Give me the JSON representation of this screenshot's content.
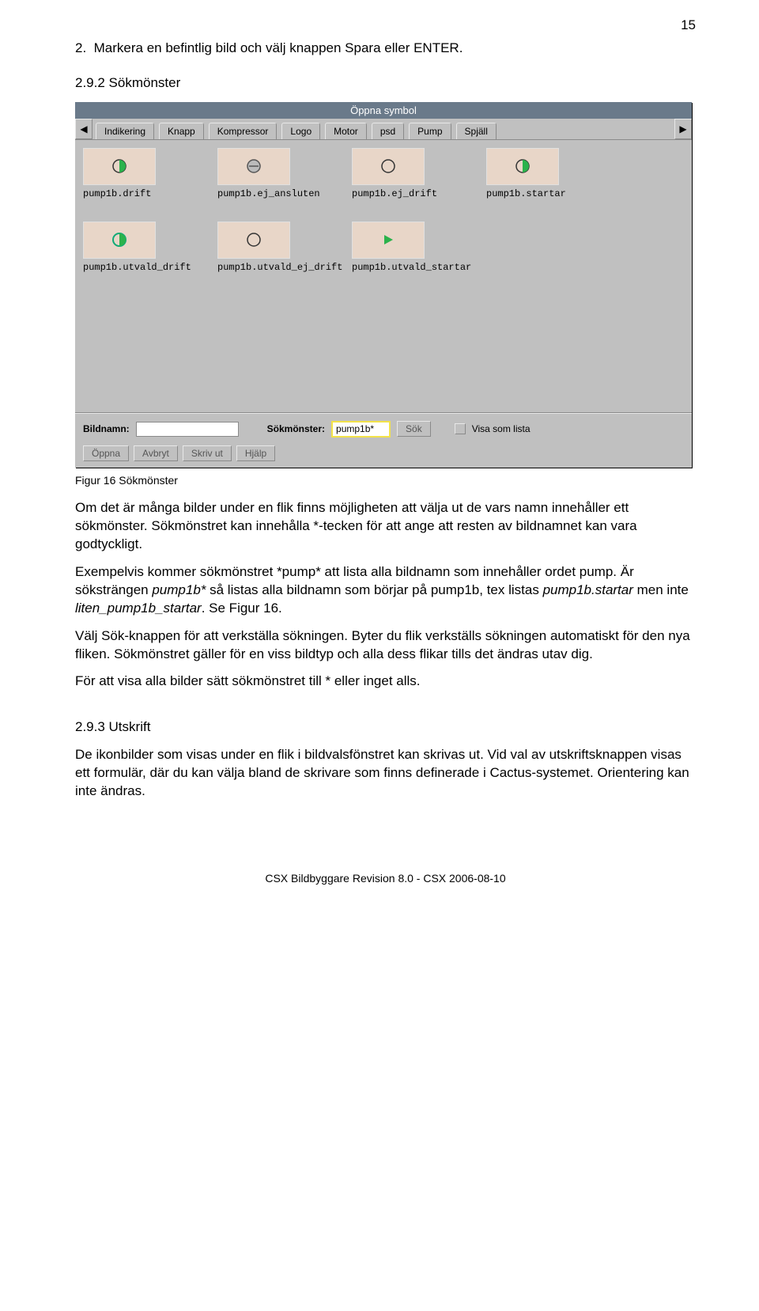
{
  "page_number": "15",
  "item": {
    "num": "2.",
    "text": "Markera en befintlig bild och välj knappen Spara eller ENTER."
  },
  "heading1": "2.9.2  Sökmönster",
  "dialog": {
    "title": "Öppna symbol",
    "tabs": [
      "Indikering",
      "Knapp",
      "Kompressor",
      "Logo",
      "Motor",
      "psd",
      "Pump",
      "Spjäll"
    ],
    "row1": [
      {
        "label": "pump1b.drift",
        "icon": "drift"
      },
      {
        "label": "pump1b.ej_ansluten",
        "icon": "ej_ansluten"
      },
      {
        "label": "pump1b.ej_drift",
        "icon": "ej_drift"
      },
      {
        "label": "pump1b.startar",
        "icon": "startar"
      }
    ],
    "row2": [
      {
        "label": "pump1b.utvald_drift",
        "icon": "utvald_drift"
      },
      {
        "label": "pump1b.utvald_ej_drift",
        "icon": "utvald_ej_drift"
      },
      {
        "label": "pump1b.utvald_startar",
        "icon": "utvald_startar"
      }
    ],
    "bildnamn_label": "Bildnamn:",
    "bildnamn_value": "",
    "sokmonster_label": "Sökmönster:",
    "sokmonster_value": "pump1b*",
    "sok_btn": "Sök",
    "visa_lista": "Visa som lista",
    "buttons": [
      "Öppna",
      "Avbryt",
      "Skriv ut",
      "Hjälp"
    ]
  },
  "caption1": "Figur 16 Sökmönster",
  "para1": "Om det är många bilder under en flik finns möjligheten att välja ut de vars namn innehåller ett sökmönster. Sökmönstret kan innehålla *-tecken för att ange att resten av bildnamnet kan vara godtyckligt.",
  "para2_a": "Exempelvis kommer sökmönstret *pump* att lista alla bildnamn som innehåller ordet pump. Är söksträngen ",
  "para2_i1": "pump1b*",
  "para2_b": " så listas alla bildnamn som börjar på pump1b, tex listas ",
  "para2_i2": "pump1b.startar",
  "para2_c": "  men inte ",
  "para2_i3": "liten_pump1b_startar",
  "para2_d": ". Se Figur 16.",
  "para3": "Välj Sök-knappen för att verkställa sökningen. Byter du flik verkställs sökningen automatiskt för den nya fliken. Sökmönstret gäller för en viss bildtyp och alla dess flikar tills det ändras utav dig.",
  "para4": "För att visa alla bilder sätt sökmönstret till * eller inget alls.",
  "heading2": "2.9.3  Utskrift",
  "para5": "De ikonbilder som visas under en flik i bildvalsfönstret kan skrivas ut. Vid val av utskriftsknappen visas ett formulär, där du kan välja bland de skrivare som finns definerade i Cactus-systemet. Orientering kan inte ändras.",
  "footer": "CSX Bildbyggare Revision 8.0 - CSX 2006-08-10"
}
